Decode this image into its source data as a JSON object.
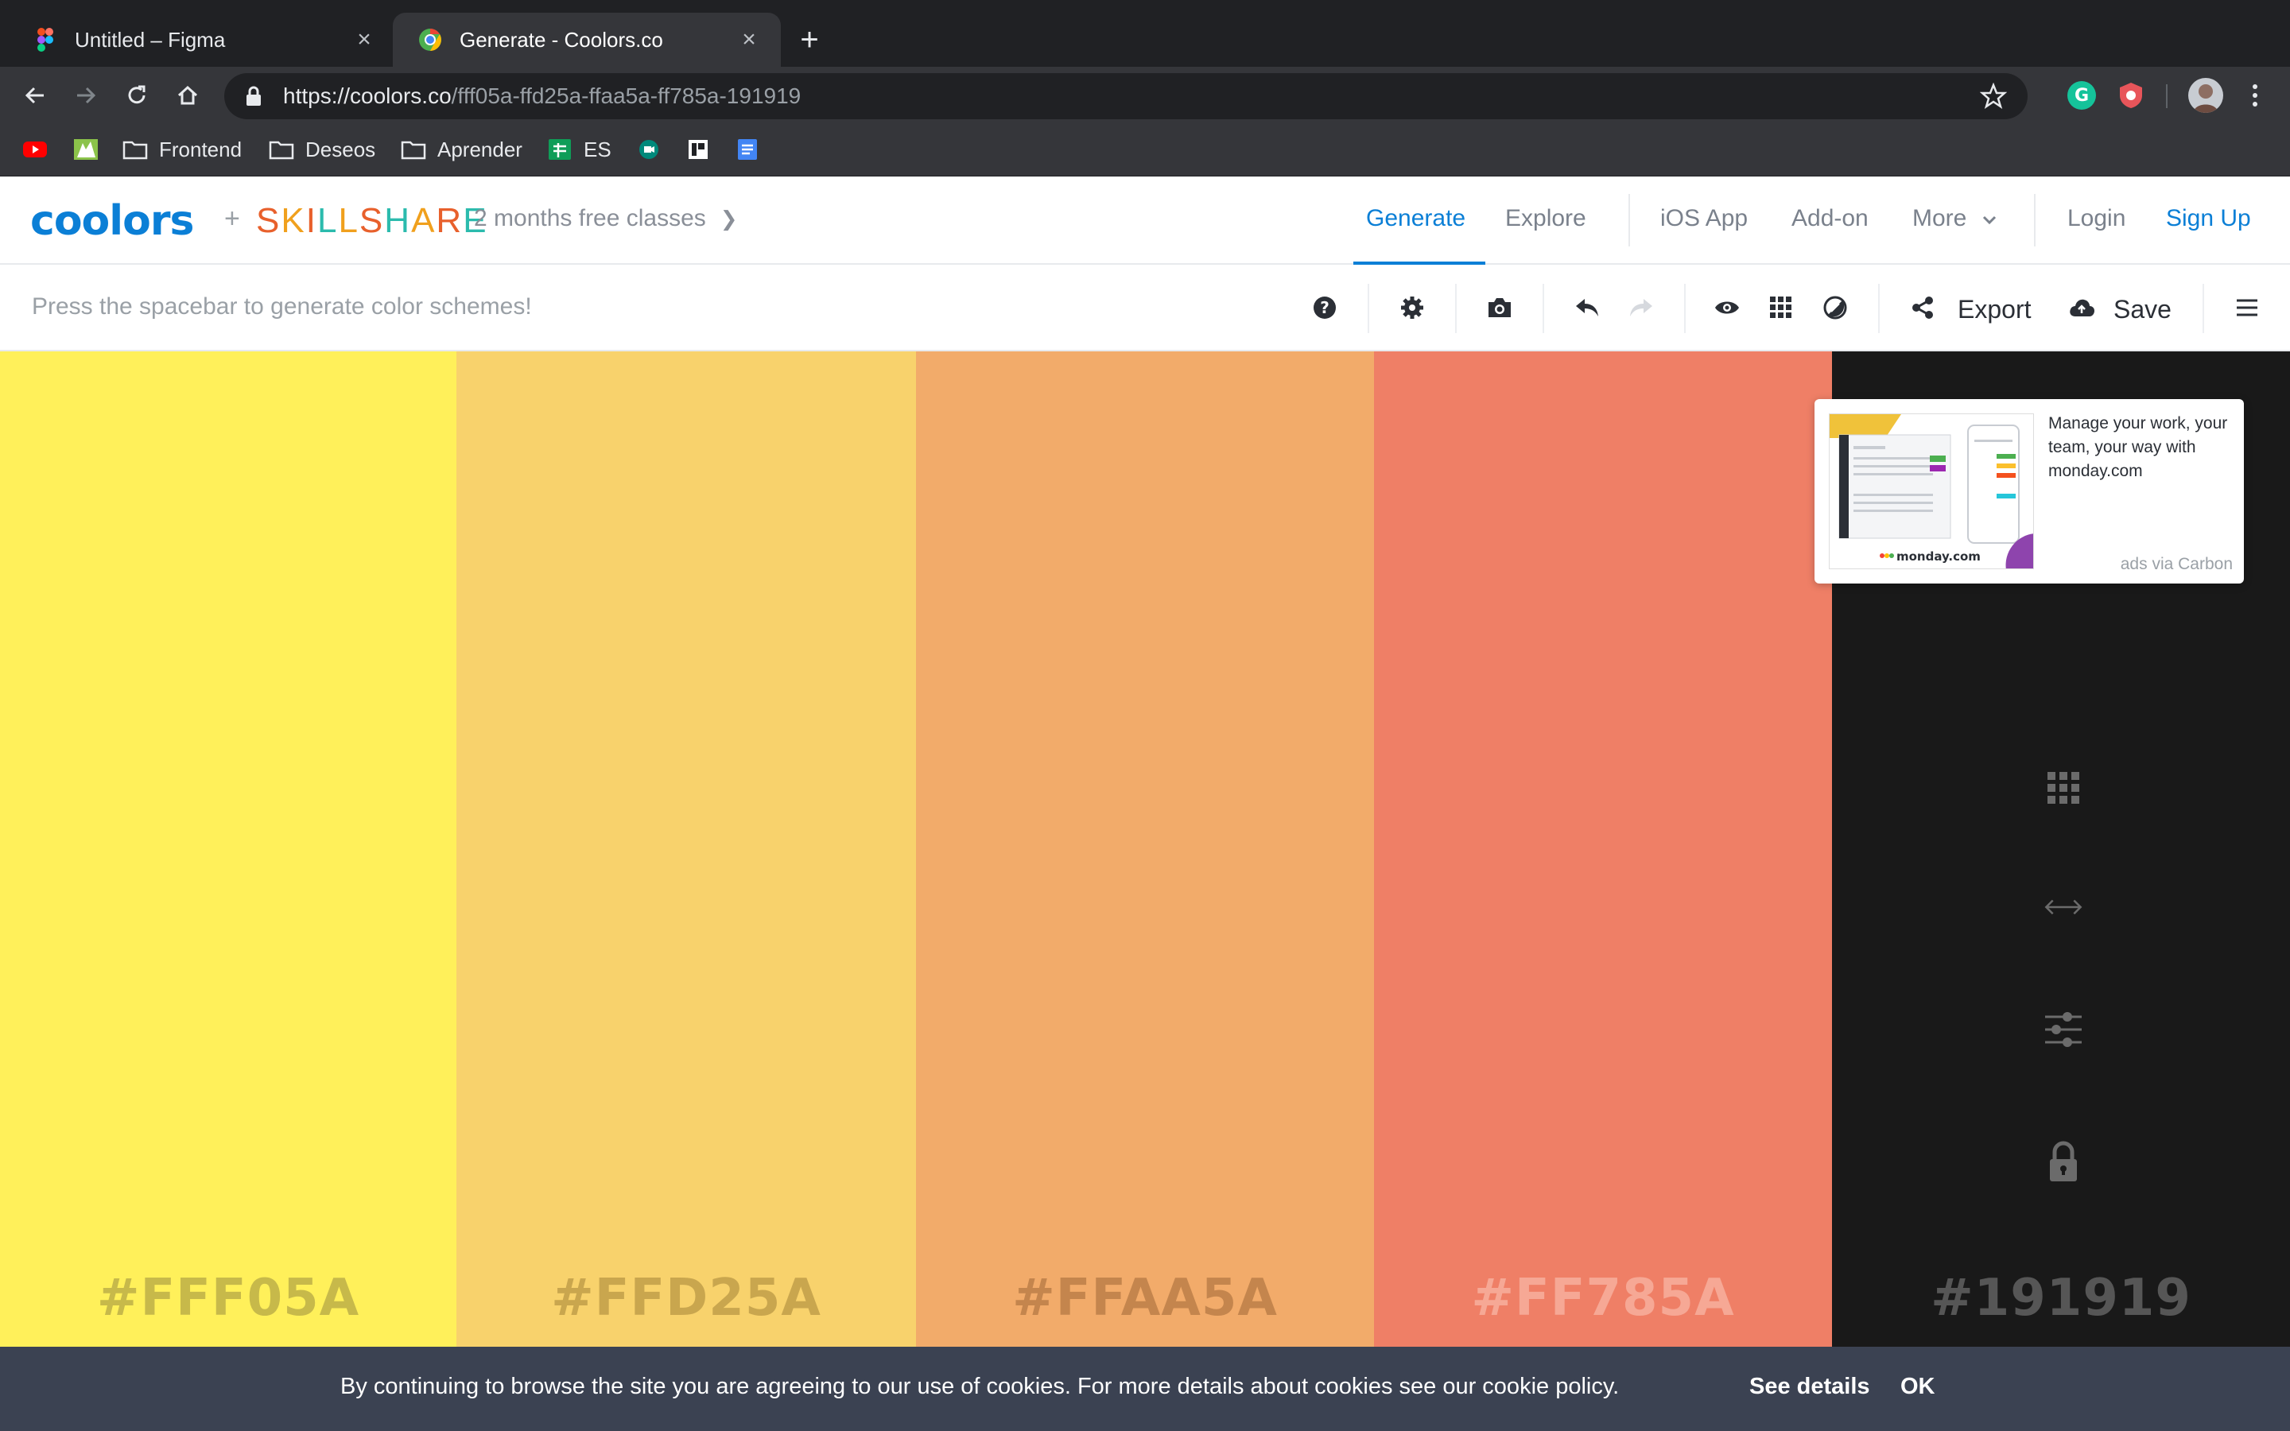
{
  "browser": {
    "tabs": [
      {
        "title": "Untitled – Figma",
        "active": false,
        "icon": "figma-icon"
      },
      {
        "title": "Generate - Coolors.co",
        "active": true,
        "icon": "chrome-icon"
      }
    ],
    "url_host": "https://coolors.co",
    "url_path": "/fff05a-ffd25a-ffaa5a-ff785a-191919",
    "bookmarks": [
      {
        "label": "",
        "icon": "youtube-icon"
      },
      {
        "label": "",
        "icon": "bookmark-app-icon"
      },
      {
        "label": "Frontend",
        "icon": "folder-icon"
      },
      {
        "label": "Deseos",
        "icon": "folder-icon"
      },
      {
        "label": "Aprender",
        "icon": "folder-icon"
      },
      {
        "label": "ES",
        "icon": "sheets-icon"
      },
      {
        "label": "",
        "icon": "meet-icon"
      },
      {
        "label": "",
        "icon": "bookmark-app-icon"
      },
      {
        "label": "",
        "icon": "docs-icon"
      }
    ]
  },
  "header": {
    "logo": "coolors",
    "partner_plus": "+",
    "partner": "SKILLSHARE",
    "promo": "2 months free classes",
    "nav": {
      "generate": "Generate",
      "explore": "Explore",
      "ios_app": "iOS App",
      "add_on": "Add-on",
      "more": "More",
      "login": "Login",
      "sign_up": "Sign Up"
    }
  },
  "toolbar": {
    "hint": "Press the spacebar to generate color schemes!",
    "export": "Export",
    "save": "Save"
  },
  "palette": {
    "colors": [
      {
        "hex": "#FFF05A",
        "bg": "#fff05a",
        "label_color": "#c7b94a"
      },
      {
        "hex": "#FFD25A",
        "bg": "#f8d26c",
        "label_color": "#c9a64e"
      },
      {
        "hex": "#FFAA5A",
        "bg": "#f2ab6a",
        "label_color": "#c4854d"
      },
      {
        "hex": "#FF785A",
        "bg": "#ef7f66",
        "label_color": "#f6a895"
      },
      {
        "hex": "#191919",
        "bg": "#191919",
        "label_color": "#565656"
      }
    ]
  },
  "ad": {
    "text": "Manage your work, your team, your way with monday.com",
    "via": "ads via Carbon",
    "brand": "monday.com"
  },
  "cookie": {
    "message": "By continuing to browse the site you are agreeing to our use of cookies. For more details about cookies see our cookie policy.",
    "details": "See details",
    "ok": "OK"
  }
}
